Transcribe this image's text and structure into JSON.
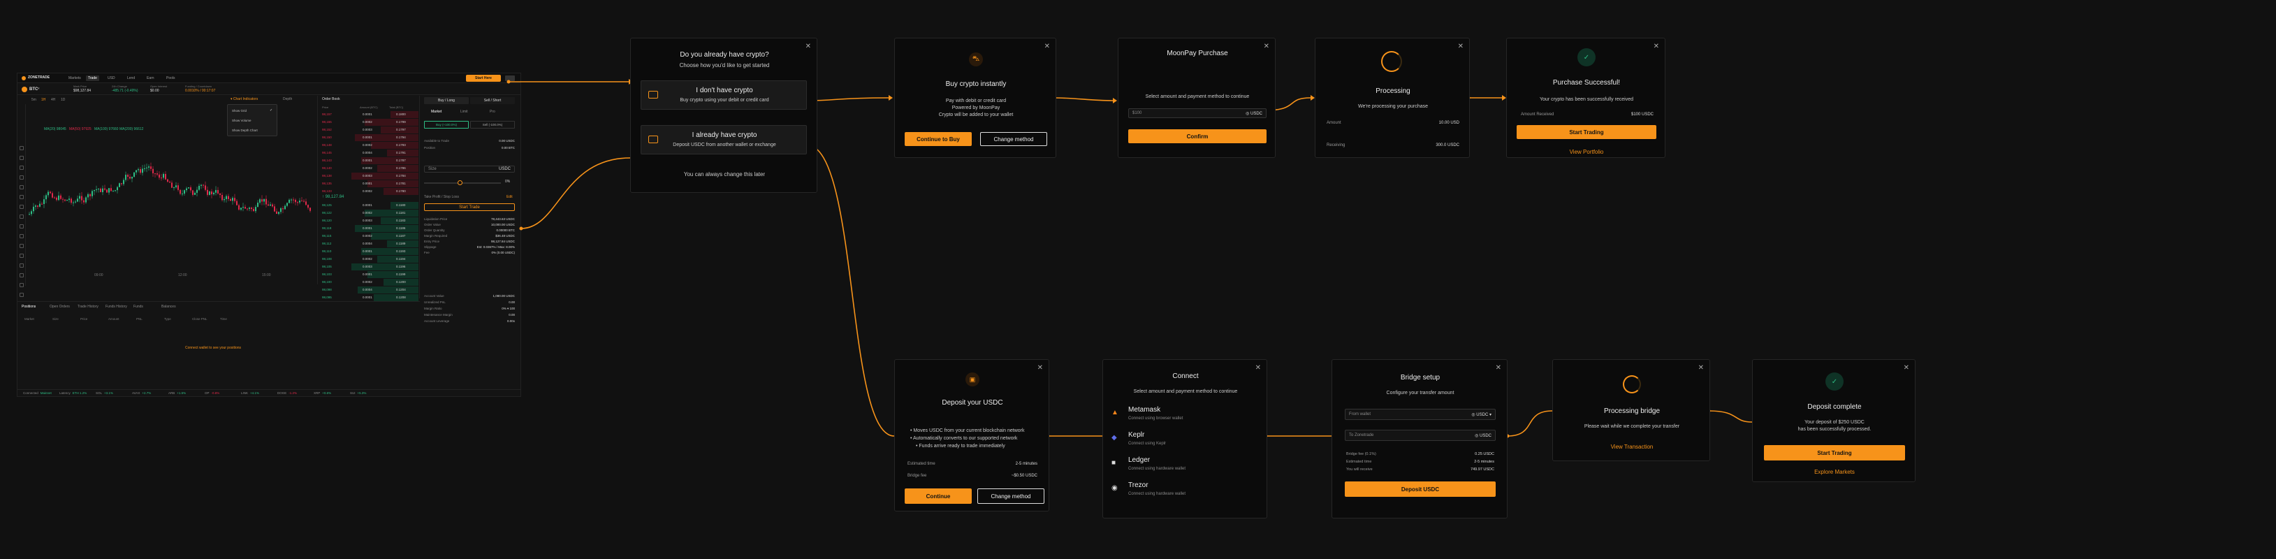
{
  "trading": {
    "brand": "ZONETRADE",
    "nav": [
      "Markets",
      "Trade",
      "USD",
      "Lend",
      "Earn",
      "Pools"
    ],
    "nav_active": "Trade",
    "start_here": "Start Here",
    "symbol": "BTC",
    "price_stats": [
      {
        "label": "Mark Price",
        "value": "$98,127.84"
      },
      {
        "label": "24h Change",
        "value": "-485.71 (-0.49%)"
      },
      {
        "label": "Open Interest",
        "value": "$0.00"
      },
      {
        "label": "Funding / Countdown",
        "value": "0.0010% / 00:17:07"
      }
    ],
    "chart_tabs": [
      "5m",
      "1H",
      "4H",
      "1D"
    ],
    "indicator_menu": [
      "Show Grid",
      "Show Volume",
      "Show Depth Chart"
    ],
    "ma_labels": [
      "MA(20) 98045",
      "MA(50) 97925",
      "MA(100) 97660",
      "MA(200) 96612"
    ],
    "chart_x_labels": [
      "09:00",
      "12:00",
      "15:00"
    ],
    "orderbook_title": "Order Book",
    "orderbook_cols": [
      "Price",
      "Amount (BTC)",
      "Total (BTC)"
    ],
    "mid_price": "98,127.84",
    "asks": [
      [
        "98,157",
        "0.0001",
        "0.1800"
      ],
      [
        "98,155",
        "0.0002",
        "0.1799"
      ],
      [
        "98,152",
        "0.0003",
        "0.1797"
      ],
      [
        "98,150",
        "0.0001",
        "0.1794"
      ],
      [
        "98,148",
        "0.0002",
        "0.1793"
      ],
      [
        "98,145",
        "0.0004",
        "0.1791"
      ],
      [
        "98,143",
        "0.0001",
        "0.1787"
      ],
      [
        "98,140",
        "0.0002",
        "0.1786"
      ],
      [
        "98,138",
        "0.0003",
        "0.1784"
      ],
      [
        "98,135",
        "0.0001",
        "0.1781"
      ],
      [
        "98,133",
        "0.0002",
        "0.1780"
      ]
    ],
    "bids": [
      [
        "98,125",
        "0.0001",
        "0.1180"
      ],
      [
        "98,122",
        "0.0002",
        "0.1181"
      ],
      [
        "98,120",
        "0.0003",
        "0.1183"
      ],
      [
        "98,118",
        "0.0001",
        "0.1186"
      ],
      [
        "98,115",
        "0.0002",
        "0.1187"
      ],
      [
        "98,112",
        "0.0004",
        "0.1189"
      ],
      [
        "98,110",
        "0.0001",
        "0.1193"
      ],
      [
        "98,108",
        "0.0002",
        "0.1194"
      ],
      [
        "98,105",
        "0.0003",
        "0.1196"
      ],
      [
        "98,103",
        "0.0001",
        "0.1199"
      ],
      [
        "98,100",
        "0.0002",
        "0.1200"
      ],
      [
        "98,098",
        "0.0004",
        "0.1204"
      ],
      [
        "98,095",
        "0.0001",
        "0.1208"
      ]
    ],
    "order_tabs": [
      "Market",
      "Limit",
      "Pro"
    ],
    "side_tabs": [
      "Buy / Long",
      "Sell / Short"
    ],
    "side_tabs2": [
      "Buy (+100.0%)",
      "Sell (-100.0%)"
    ],
    "order_rows": [
      {
        "label": "Available to Trade",
        "value": "0.00 USDC"
      },
      {
        "label": "Position",
        "value": "0.00 BTC"
      }
    ],
    "size_placeholder": "Size",
    "size_unit": "USDC",
    "slider_pct": "0%",
    "tpsl": "Take Profit / Stop Loss",
    "start_trading": "Start Trade",
    "info_rows": [
      {
        "label": "Liquidation Price",
        "value": "78,443.63 USDC"
      },
      {
        "label": "Order Value",
        "value": "10,000.00 USDC"
      },
      {
        "label": "Order Quantity",
        "value": "0.00000 BTC"
      },
      {
        "label": "Margin Required",
        "value": "$36.48 USDC"
      },
      {
        "label": "Entry Price",
        "value": "98,127.84 USDC"
      },
      {
        "label": "Slippage",
        "value": "Est: 0.0367% / Max: 8.00%"
      },
      {
        "label": "Fee",
        "value": "0% (0.00 USDC)"
      }
    ],
    "account_rows": [
      {
        "label": "Account Value",
        "value": "1,080.00 USDC"
      },
      {
        "label": "Unrealized PnL",
        "value": "0.00"
      },
      {
        "label": "Margin Ratio",
        "value": "0% ▾ 100"
      },
      {
        "label": "Maintenance Margin",
        "value": "0.00"
      },
      {
        "label": "Account Leverage",
        "value": "0.00x"
      }
    ],
    "bottom_tabs": [
      "Positions",
      "Open Orders",
      "Trade History",
      "Funds History",
      "Funds",
      "Balances"
    ],
    "bottom_cols": [
      "Market",
      "Size",
      "Price",
      "Amount",
      "PNL",
      "Type",
      "Close PNL",
      "Time"
    ],
    "empty_msg": "Connect wallet to see your positions",
    "ticker": [
      {
        "name": "Connected",
        "val": "Mainnet"
      },
      {
        "name": "Latency",
        "val": "ETH 1.2%"
      },
      {
        "name": "SOL",
        "val": "+3.1%"
      },
      {
        "name": "AVAX",
        "val": "+2.7%"
      },
      {
        "name": "ARB",
        "val": "+1.5%"
      },
      {
        "name": "OP",
        "val": "-0.8%"
      },
      {
        "name": "LINK",
        "val": "+4.1%"
      },
      {
        "name": "DOGE",
        "val": "-1.2%"
      },
      {
        "name": "XRP",
        "val": "+0.6%"
      },
      {
        "name": "SUI",
        "val": "+5.3%"
      }
    ]
  },
  "choice": {
    "title": "Do you already have crypto?",
    "subtitle": "Choose how you'd like to get started",
    "opt1_title": "I don't have crypto",
    "opt1_sub": "Buy crypto using your debit or credit card",
    "opt2_title": "I already have crypto",
    "opt2_sub": "Deposit USDC from another wallet or exchange",
    "footer": "You can always change this later"
  },
  "buy": {
    "title": "Buy crypto instantly",
    "lines": [
      "Pay with debit or credit card",
      "Powered by MoonPay",
      "Crypto will be added to your wallet"
    ],
    "primary": "Continue to Buy",
    "secondary": "Change method"
  },
  "moonpay": {
    "title": "MoonPay Purchase",
    "label": "Select amount and payment method to continue",
    "input_val": "$100",
    "input_unit": "USDC",
    "button": "Confirm"
  },
  "processing": {
    "title": "Processing",
    "sub": "We're processing your purchase",
    "rows": [
      {
        "label": "Amount",
        "value": "10.00 USD"
      },
      {
        "label": "Receiving",
        "value": "300.0 USDC"
      }
    ]
  },
  "success": {
    "title": "Purchase Successful!",
    "sub": "Your crypto has been successfully received",
    "row_label": "Amount Received",
    "row_value": "$100 USDC",
    "button": "Start Trading",
    "link": "View Portfolio"
  },
  "deposit": {
    "title": "Deposit your USDC",
    "bullets": [
      "Moves USDC from your current blockchain network",
      "Automatically converts to our supported network",
      "Funds arrive ready to trade immediately"
    ],
    "rows": [
      {
        "label": "Estimated time",
        "value": "2-5 minutes"
      },
      {
        "label": "Bridge fee",
        "value": "~$0.50 USDC"
      }
    ],
    "primary": "Continue",
    "secondary": "Change method"
  },
  "connect": {
    "title": "Connect",
    "sub": "Select amount and payment method to continue",
    "wallets": [
      {
        "name": "Metamask",
        "desc": "Connect using browser wallet"
      },
      {
        "name": "Keplr",
        "desc": "Connect using Keplr"
      },
      {
        "name": "Ledger",
        "desc": "Connect using hardware wallet"
      },
      {
        "name": "Trezor",
        "desc": "Connect using hardware wallet"
      }
    ]
  },
  "bridge": {
    "title": "Bridge setup",
    "sub": "Configure your transfer amount",
    "from_label": "From wallet",
    "from_unit": "USDC",
    "to_label": "To Zonetrade",
    "to_unit": "USDC",
    "rows": [
      {
        "label": "Bridge fee (0.1%)",
        "value": "0.25 USDC"
      },
      {
        "label": "Estimated time",
        "value": "2-5 minutes"
      },
      {
        "label": "You will receive",
        "value": "749.97 USDC"
      }
    ],
    "button": "Deposit USDC"
  },
  "bridging": {
    "title": "Processing bridge",
    "sub": "Please wait while we complete your transfer",
    "link": "View Transaction"
  },
  "complete": {
    "title": "Deposit complete",
    "line1": "Your deposit of $250 USDC",
    "line2": "has been successfully processed.",
    "button": "Start Trading",
    "link": "Explore Markets"
  },
  "colors": {
    "accent": "#f7931a",
    "bg": "#111111",
    "panel": "#0b0b0b",
    "up": "#2ebd85",
    "down": "#e0294a"
  }
}
